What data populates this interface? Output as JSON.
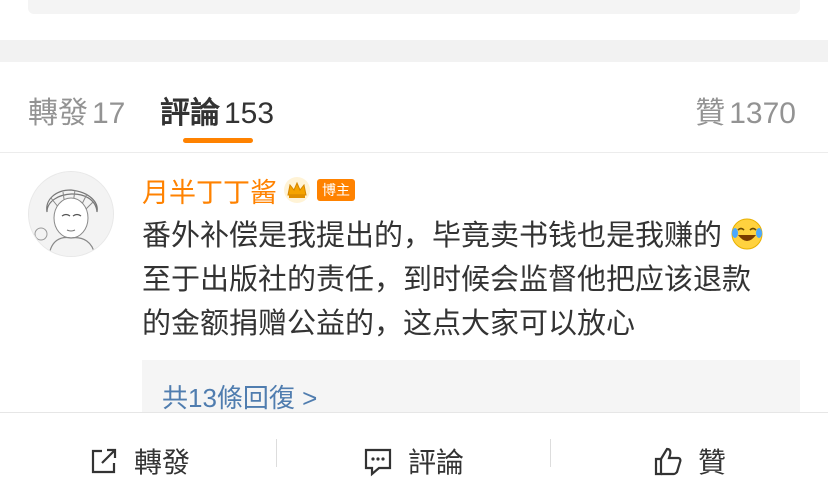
{
  "tabs": {
    "repost": {
      "label": "轉發",
      "count": "17"
    },
    "comments": {
      "label": "評論",
      "count": "153"
    },
    "likes": {
      "label": "贊",
      "count": "1370"
    }
  },
  "comment": {
    "username": "月半丁丁酱",
    "badge": "博主",
    "line1": "番外补偿是我提出的，毕竟卖书钱也是我赚的",
    "line2": "至于出版社的责任，到时候会监督他把应该退款",
    "line3": "的金额捐赠公益的，这点大家可以放心",
    "emoji": "laughing-crying-icon",
    "replies_link": "共13條回復 >"
  },
  "bottom_bar": {
    "repost": "轉發",
    "comment": "評論",
    "like": "贊"
  },
  "colors": {
    "accent": "#ff8200",
    "link": "#507daf",
    "text": "#333333",
    "muted": "#939393"
  }
}
